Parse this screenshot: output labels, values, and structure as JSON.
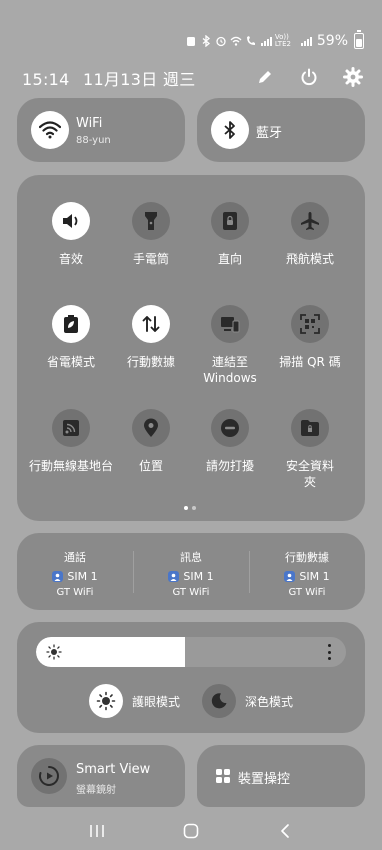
{
  "status_bar": {
    "battery_text": "59%",
    "network_label": "Vo)) LTE2"
  },
  "header": {
    "time": "15:14",
    "date": "11月13日 週三",
    "icons": [
      "edit-icon",
      "power-icon",
      "settings-icon"
    ]
  },
  "tiles": {
    "wifi": {
      "title": "WiFi",
      "subtitle": "88-yun",
      "icon": "wifi-icon",
      "active": true
    },
    "bluetooth": {
      "title": "藍牙",
      "icon": "bluetooth-icon",
      "active": true
    }
  },
  "quick_settings": [
    {
      "label": "音效",
      "icon": "sound-icon",
      "active": true
    },
    {
      "label": "手電筒",
      "icon": "flashlight-icon",
      "active": false
    },
    {
      "label": "直向",
      "icon": "portrait-lock-icon",
      "active": false
    },
    {
      "label": "飛航模式",
      "icon": "airplane-icon",
      "active": false
    },
    {
      "label": "省電模式",
      "icon": "power-saving-icon",
      "active": true
    },
    {
      "label": "行動數據",
      "icon": "mobile-data-icon",
      "active": true
    },
    {
      "label": "連結至 Windows",
      "icon": "link-to-windows-icon",
      "active": false
    },
    {
      "label": "掃描 QR 碼",
      "icon": "qr-scan-icon",
      "active": false
    },
    {
      "label": "行動無線基地台",
      "icon": "hotspot-icon",
      "active": false
    },
    {
      "label": "位置",
      "icon": "location-icon",
      "active": false
    },
    {
      "label": "請勿打擾",
      "icon": "do-not-disturb-icon",
      "active": false
    },
    {
      "label": "安全資料夾",
      "icon": "secure-folder-icon",
      "active": false
    }
  ],
  "page_indicator": {
    "total": 2,
    "current": 1
  },
  "sim_settings": [
    {
      "title": "通話",
      "sim": "SIM 1",
      "network": "GT WiFi"
    },
    {
      "title": "訊息",
      "sim": "SIM 1",
      "network": "GT WiFi"
    },
    {
      "title": "行動數據",
      "sim": "SIM 1",
      "network": "GT WiFi"
    }
  ],
  "brightness": {
    "level": 0.48,
    "modes": [
      {
        "label": "護眼模式",
        "icon": "eye-comfort-icon",
        "active": true
      },
      {
        "label": "深色模式",
        "icon": "dark-mode-icon",
        "active": false
      }
    ]
  },
  "bottom_tiles": {
    "smart_view": {
      "title": "Smart View",
      "subtitle": "螢幕鏡射",
      "icon": "smart-view-icon"
    },
    "device_control": {
      "title": "裝置操控",
      "icon": "device-control-icon"
    }
  },
  "colors": {
    "background": "#a9a9a9",
    "panel": "#8a8a8a",
    "active_circle": "#ffffff",
    "inactive_circle": "#727272",
    "sim_badge": "#4a76c9"
  }
}
